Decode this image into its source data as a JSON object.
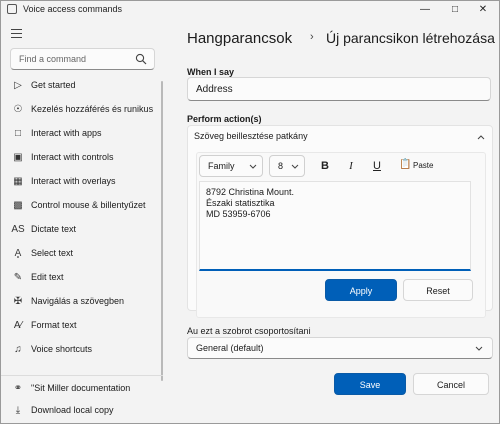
{
  "window": {
    "title": "Voice access commands"
  },
  "sidebar": {
    "search_placeholder": "Find a command",
    "items": [
      {
        "label": "Get started",
        "icon": "play-icon"
      },
      {
        "label": "Kezelés hozzáférés és runikus",
        "icon": "microphone-icon"
      },
      {
        "label": "Interact with apps",
        "icon": "apps-icon"
      },
      {
        "label": "Interact with controls",
        "icon": "controls-icon"
      },
      {
        "label": "Interact with overlays",
        "icon": "grid-icon"
      },
      {
        "label": "Control mouse & billentyűzet",
        "icon": "mouse-icon"
      },
      {
        "label": "Dictate text",
        "icon": "dictate-icon"
      },
      {
        "label": "Select text",
        "icon": "select-text-icon"
      },
      {
        "label": "Edit text",
        "icon": "edit-text-icon"
      },
      {
        "label": "Navigálás a szövegben",
        "icon": "navigate-icon"
      },
      {
        "label": "Format text",
        "icon": "format-text-icon"
      },
      {
        "label": "Voice shortcuts",
        "icon": "voice-shortcut-icon"
      }
    ],
    "footer": [
      {
        "label": "\"Sit Miller documentation",
        "icon": "globe-icon"
      },
      {
        "label": "Download local copy",
        "icon": "download-icon"
      }
    ]
  },
  "main": {
    "breadcrumb_root": "Hangparancsok",
    "breadcrumb_current": "Új parancsikon létrehozása",
    "when_label": "When I say",
    "when_value": "Address",
    "perform_label": "Perform action(s)",
    "action_value": "Szöveg beillesztése patkány",
    "toolbar": {
      "font_family": "Family",
      "font_size": "8",
      "bold": "B",
      "italic": "I",
      "underline": "U",
      "paste": "Paste"
    },
    "editor_lines": [
      "8792 Christina Mount.",
      "Északi statisztika",
      "MD 53959-6706"
    ],
    "apply_label": "Apply",
    "reset_label": "Reset",
    "group_label": "Au ezt a szobrot csoportosítani",
    "group_value": "General (default)",
    "save_label": "Save",
    "cancel_label": "Cancel"
  },
  "colors": {
    "accent": "#005fb8",
    "background": "#f3f3f3",
    "card": "#fbfbfb"
  }
}
